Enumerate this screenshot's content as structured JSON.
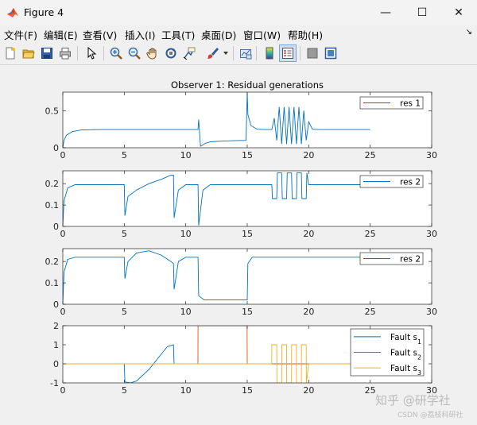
{
  "window": {
    "title": "Figure 4",
    "minimize_icon": "—",
    "maximize_icon": "☐",
    "close_icon": "✕"
  },
  "menu": {
    "items": [
      "文件(F)",
      "编辑(E)",
      "查看(V)",
      "插入(I)",
      "工具(T)",
      "桌面(D)",
      "窗口(W)",
      "帮助(H)"
    ],
    "overflow_icon": "↘"
  },
  "toolbar": {
    "icons": [
      "new-figure-icon",
      "open-file-icon",
      "save-icon",
      "print-icon",
      "pointer-icon",
      "zoom-in-icon",
      "zoom-out-icon",
      "pan-icon",
      "rotate-3d-icon",
      "data-cursor-icon",
      "brush-icon",
      "brush-dropdown-icon",
      "link-plot-icon",
      "insert-colorbar-icon",
      "insert-legend-icon",
      "hide-plot-tools-icon",
      "show-plot-tools-icon"
    ]
  },
  "colors": {
    "series1": "#0072bd",
    "series2": "#d95319",
    "series3": "#edb120",
    "axes": "#262626",
    "plot_bg": "#ffffff"
  },
  "watermark": {
    "main": "知乎 @研学社",
    "sub": "CSDN @荔枝科研社"
  },
  "chart_data": [
    {
      "type": "line",
      "title": "Observer 1: Residual generations",
      "xlim": [
        0,
        30
      ],
      "ylim": [
        0,
        0.75
      ],
      "xticks": [
        "0",
        "5",
        "10",
        "15",
        "20",
        "25",
        "30"
      ],
      "yticks": [
        "0",
        "0.5"
      ],
      "legend": {
        "placement": "top-right",
        "entries": [
          "res 1"
        ]
      },
      "series": [
        {
          "name": "res 1",
          "x": [
            0,
            0.1,
            0.3,
            0.8,
            1.5,
            3,
            6,
            9,
            10.5,
            11,
            11.05,
            11.2,
            11.6,
            12,
            13,
            14,
            14.9,
            15,
            15.05,
            15.3,
            15.8,
            16.5,
            17,
            17.2,
            17.4,
            17.6,
            17.8,
            18,
            18.2,
            18.4,
            18.6,
            18.8,
            19,
            19.2,
            19.4,
            19.6,
            19.8,
            20,
            20.3,
            21,
            23,
            25
          ],
          "y": [
            0,
            0.1,
            0.17,
            0.22,
            0.24,
            0.245,
            0.245,
            0.245,
            0.245,
            0.245,
            0.38,
            0.02,
            0.06,
            0.08,
            0.09,
            0.095,
            0.1,
            0.75,
            0.45,
            0.3,
            0.25,
            0.245,
            0.245,
            0.4,
            0.1,
            0.55,
            0.05,
            0.55,
            0.05,
            0.55,
            0.05,
            0.55,
            0.05,
            0.55,
            0.05,
            0.5,
            0.1,
            0.35,
            0.25,
            0.245,
            0.245,
            0.245
          ]
        }
      ]
    },
    {
      "type": "line",
      "title": "",
      "xlim": [
        0,
        30
      ],
      "ylim": [
        0,
        0.26
      ],
      "xticks": [
        "0",
        "5",
        "10",
        "15",
        "20",
        "25",
        "30"
      ],
      "yticks": [
        "0",
        "0.1",
        "0.2"
      ],
      "legend": {
        "placement": "top-right",
        "entries": [
          "res 2"
        ]
      },
      "series": [
        {
          "name": "res 2",
          "x": [
            0,
            0.1,
            0.4,
            1,
            2,
            5,
            5.05,
            5.3,
            6,
            7,
            8,
            8.8,
            9,
            9.05,
            9.4,
            10,
            11,
            11.05,
            11.4,
            12,
            14,
            17,
            17.05,
            17.4,
            17.45,
            17.8,
            17.85,
            18.2,
            18.25,
            18.6,
            18.65,
            19,
            19.05,
            19.4,
            19.45,
            19.8,
            19.85,
            20,
            25
          ],
          "y": [
            0,
            0.12,
            0.18,
            0.195,
            0.195,
            0.195,
            0.05,
            0.14,
            0.17,
            0.2,
            0.22,
            0.24,
            0.24,
            0.04,
            0.17,
            0.195,
            0.195,
            0.005,
            0.17,
            0.195,
            0.195,
            0.195,
            0.13,
            0.13,
            0.25,
            0.25,
            0.13,
            0.13,
            0.25,
            0.25,
            0.13,
            0.13,
            0.25,
            0.25,
            0.13,
            0.13,
            0.25,
            0.195,
            0.195
          ]
        }
      ]
    },
    {
      "type": "line",
      "title": "",
      "xlim": [
        0,
        30
      ],
      "ylim": [
        0,
        0.26
      ],
      "xticks": [
        "0",
        "5",
        "10",
        "15",
        "20",
        "25",
        "30"
      ],
      "yticks": [
        "0",
        "0.1",
        "0.2"
      ],
      "legend": {
        "placement": "top-right",
        "entries": [
          "res 2"
        ]
      },
      "series": [
        {
          "name": "res 2",
          "x": [
            0,
            0.1,
            0.4,
            1,
            2,
            5,
            5.05,
            5.3,
            6,
            7,
            8,
            8.8,
            9,
            9.05,
            9.4,
            10,
            10.9,
            11,
            11.05,
            11.5,
            12,
            14.9,
            15,
            15.05,
            15.4,
            16,
            20,
            25
          ],
          "y": [
            0,
            0.15,
            0.21,
            0.22,
            0.22,
            0.22,
            0.12,
            0.2,
            0.24,
            0.25,
            0.23,
            0.2,
            0.19,
            0.07,
            0.2,
            0.22,
            0.22,
            0.22,
            0.04,
            0.02,
            0.02,
            0.02,
            0.02,
            0.19,
            0.22,
            0.22,
            0.22,
            0.22
          ]
        }
      ]
    },
    {
      "type": "line",
      "title": "",
      "xlim": [
        0,
        30
      ],
      "ylim": [
        -1,
        2
      ],
      "xticks": [
        "0",
        "5",
        "10",
        "15",
        "20",
        "25",
        "30"
      ],
      "yticks": [
        "-1",
        "0",
        "1",
        "2"
      ],
      "legend": {
        "placement": "top-right",
        "entries": [
          "Fault s1",
          "Fault s2",
          "Fault s3"
        ]
      },
      "series": [
        {
          "name": "Fault s1",
          "x": [
            0,
            5,
            5.05,
            5.5,
            6,
            7,
            8,
            8.5,
            9,
            9.05,
            10,
            25
          ],
          "y": [
            0,
            0,
            -0.95,
            -1,
            -0.9,
            -0.3,
            0.5,
            0.9,
            1,
            0,
            0,
            0
          ]
        },
        {
          "name": "Fault s2",
          "x": [
            0,
            10.99,
            11,
            14.99,
            15,
            25
          ],
          "y": [
            0,
            0,
            2,
            2,
            0,
            0
          ]
        },
        {
          "name": "Fault s3",
          "x": [
            0,
            16.99,
            17,
            17.4,
            17.41,
            17.8,
            17.81,
            18.2,
            18.21,
            18.6,
            18.61,
            19,
            19.01,
            19.4,
            19.41,
            19.8,
            19.81,
            20,
            25
          ],
          "y": [
            0,
            0,
            1,
            1,
            -1,
            -1,
            1,
            1,
            -1,
            -1,
            1,
            1,
            -1,
            -1,
            1,
            1,
            -1,
            0,
            0
          ]
        }
      ]
    }
  ]
}
